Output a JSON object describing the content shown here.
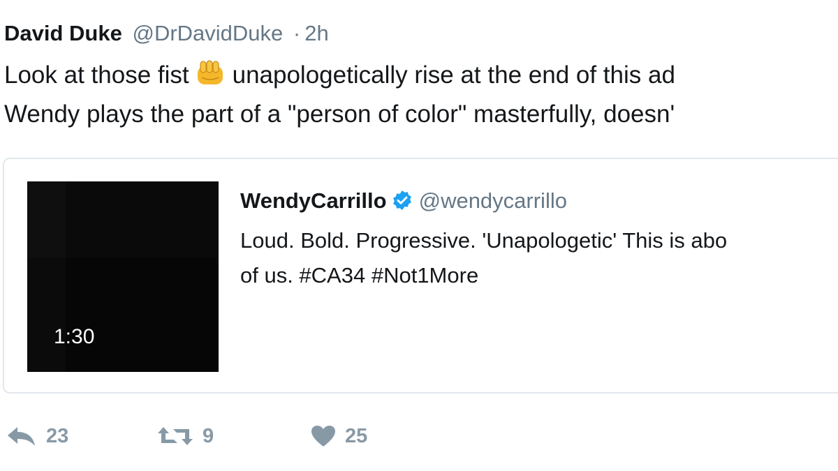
{
  "tweet": {
    "author_name": "David Duke",
    "author_handle": "@DrDavidDuke",
    "separator": "·",
    "timestamp": "2h",
    "text_line1_before": "Look at those fist",
    "text_line1_after": "unapologetically rise at the end of this ad",
    "text_line2": "Wendy plays the part of a \"person of color\" masterfully, doesn'",
    "fist_icon": "oncoming-fist-emoji"
  },
  "quoted_tweet": {
    "author_name": "WendyCarrillo",
    "verified_icon": "verified-badge-icon",
    "author_handle": "@wendycarrillo",
    "text_line1": "Loud. Bold. Progressive. 'Unapologetic' This is abo",
    "text_line2": "of us. #CA34 #Not1More",
    "video_duration": "1:30"
  },
  "actions": {
    "reply_count": "23",
    "retweet_count": "9",
    "like_count": "25"
  },
  "colors": {
    "text": "#14171a",
    "secondary": "#657786",
    "action_gray": "#8899a6",
    "verified_blue": "#1da1f2",
    "card_border": "#e1e8ed"
  }
}
